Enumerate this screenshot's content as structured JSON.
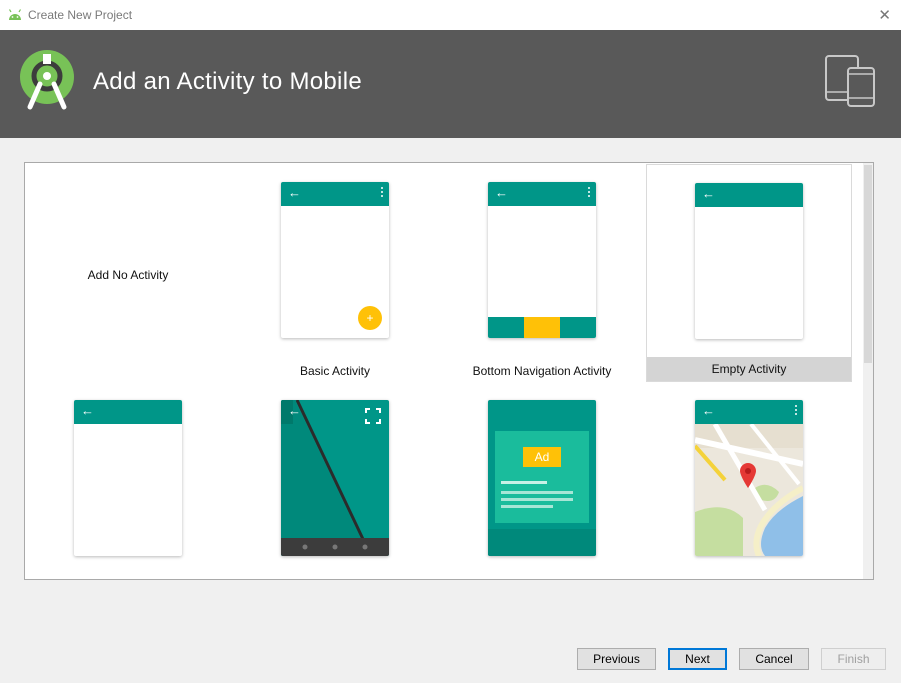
{
  "window": {
    "title": "Create New Project",
    "close_glyph": "✕"
  },
  "header": {
    "title": "Add an Activity to Mobile"
  },
  "templates": [
    {
      "label": "Add No Activity"
    },
    {
      "label": "Basic Activity",
      "fab": "+"
    },
    {
      "label": "Bottom Navigation Activity"
    },
    {
      "label": "Empty Activity",
      "selected": true
    },
    {
      "label": ""
    },
    {
      "label": ""
    },
    {
      "label": "",
      "ad": "Ad"
    },
    {
      "label": ""
    }
  ],
  "glyphs": {
    "back": "←"
  },
  "buttons": {
    "previous": "Previous",
    "next": "Next",
    "cancel": "Cancel",
    "finish": "Finish"
  },
  "colors": {
    "accent": "#009688",
    "accent_dark": "#00796b",
    "fab": "#ffc107",
    "header": "#595959"
  }
}
